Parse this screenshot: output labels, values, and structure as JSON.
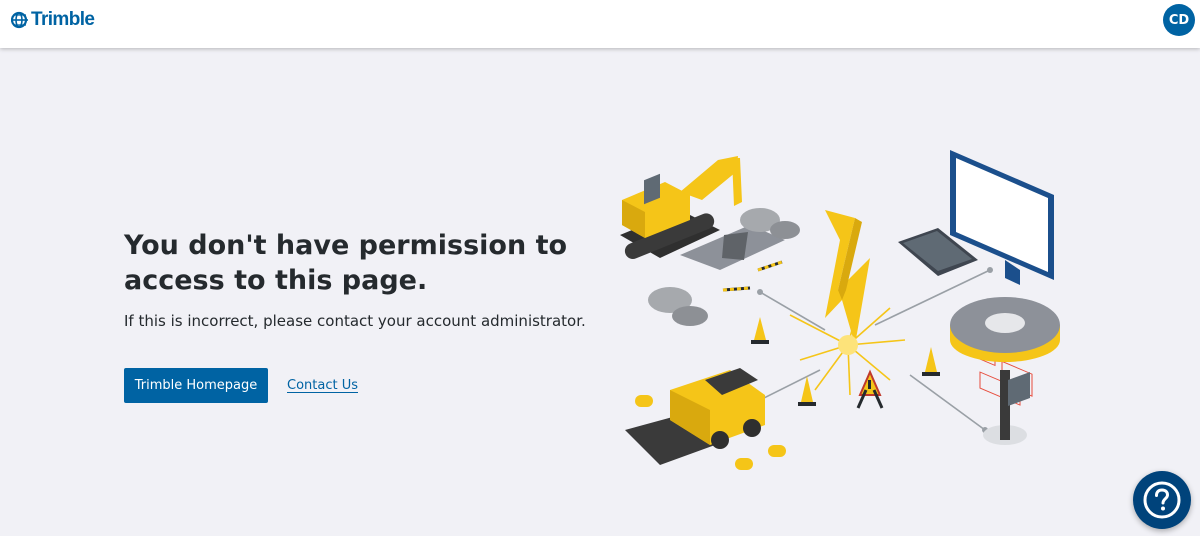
{
  "header": {
    "brand": "Trimble",
    "user_initials": "CD"
  },
  "main": {
    "title": "You don't have permission to access to this page.",
    "message": "If this is incorrect, please contact your account administrator.",
    "primary_button": "Trimble Homepage",
    "secondary_link": "Contact Us"
  },
  "help": {
    "icon": "question-mark-icon"
  },
  "colors": {
    "brand_blue": "#0063a3",
    "help_navy": "#00437b",
    "background": "#f1f1f6",
    "illustration_yellow": "#f5c518"
  }
}
